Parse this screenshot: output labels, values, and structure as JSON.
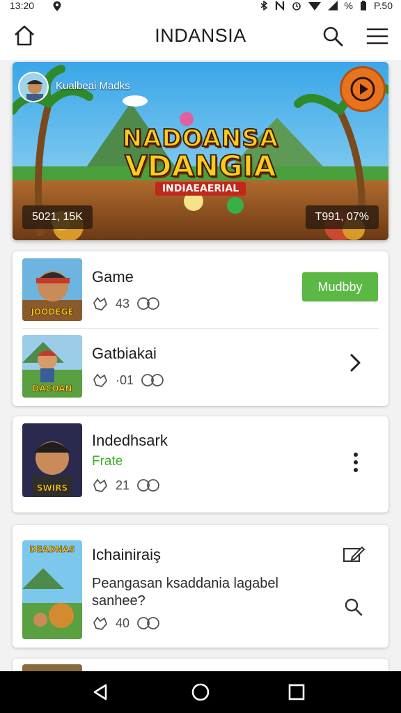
{
  "status_bar": {
    "time": "13:20",
    "right_text": "%",
    "battery_time": "P.50",
    "icons": [
      "location-icon",
      "bluetooth-icon",
      "nfc-icon",
      "alarm-icon",
      "wifi-icon",
      "signal-icon",
      "battery-icon"
    ]
  },
  "app_bar": {
    "title": "INDANSIA",
    "icons": [
      "home-icon",
      "search-icon",
      "hamburger-menu-icon"
    ]
  },
  "banner": {
    "channel_name": "Kualbeai Madks",
    "game_title_line1": "NADOANSA",
    "game_title_line2": "VDANGIA",
    "game_title_line3": "INDIAEAERIAL",
    "stat_left": "5021, 15K",
    "stat_right": "T991, 07%",
    "play_icon": "play-circle-icon"
  },
  "list": {
    "card1": {
      "items": [
        {
          "name": "Game",
          "thumb_label": "JOODEGE",
          "likes": "43",
          "action_label": "Mudbby",
          "meta_icons": [
            "like-icon",
            "views-icon"
          ]
        },
        {
          "name": "Gatbiakai",
          "thumb_label": "DACOAN",
          "likes": "·01",
          "action_icon": "chevron-right-icon",
          "meta_icons": [
            "like-icon",
            "views-icon"
          ]
        }
      ]
    },
    "card2": {
      "name": "Indedhsark",
      "subtitle": "Frate",
      "thumb_label": "SWIRS",
      "likes": "21",
      "action_icon": "more-vert-icon",
      "meta_icons": [
        "like-icon",
        "views-icon"
      ]
    },
    "card3": {
      "name": "Ichainiraiş",
      "description": "Peangasan ksaddania lagabel sanhee?",
      "thumb_label": "DEADNAS",
      "likes": "40",
      "action_icons": [
        "edit-icon",
        "search-icon"
      ],
      "meta_icons": [
        "like-icon",
        "views-icon"
      ]
    }
  },
  "nav_bar": {
    "icons": [
      "back-icon",
      "home-circle-icon",
      "recents-icon"
    ]
  },
  "colors": {
    "accent_green": "#5cb845",
    "subtitle_green": "#3fae2c",
    "play_orange": "#e8731e"
  }
}
